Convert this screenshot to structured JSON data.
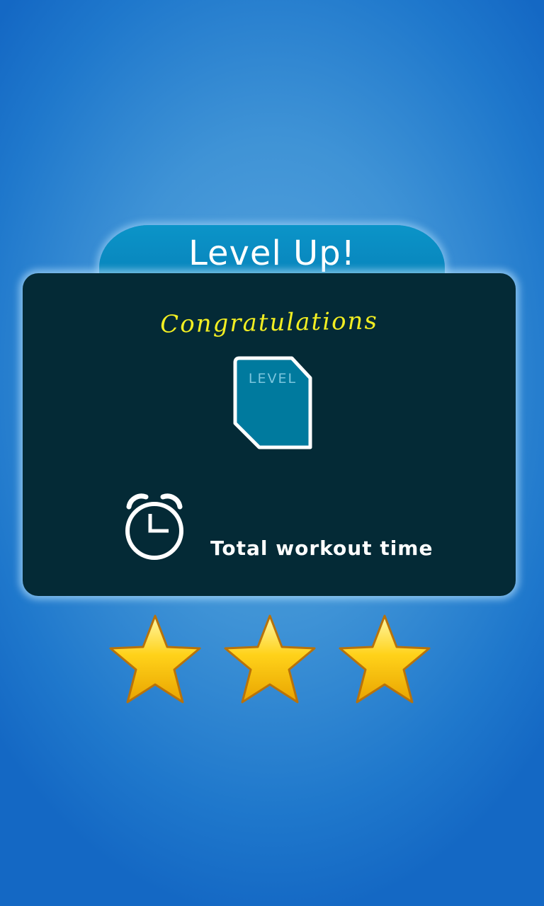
{
  "header": {
    "title": "Level Up!"
  },
  "card": {
    "congrats_text": "Congratulations",
    "badge": {
      "icon": "level-badge-icon",
      "label": "LEVEL"
    },
    "workout": {
      "icon": "alarm-clock-icon",
      "label": "Total workout time"
    }
  },
  "rating": {
    "stars": 3,
    "max_stars": 3,
    "icon": "star-icon"
  },
  "colors": {
    "background": "#3f93d6",
    "tab": "#0b94c8",
    "card": "#042a36",
    "congrats": "#f2ee22",
    "star": "#ffd21a"
  }
}
